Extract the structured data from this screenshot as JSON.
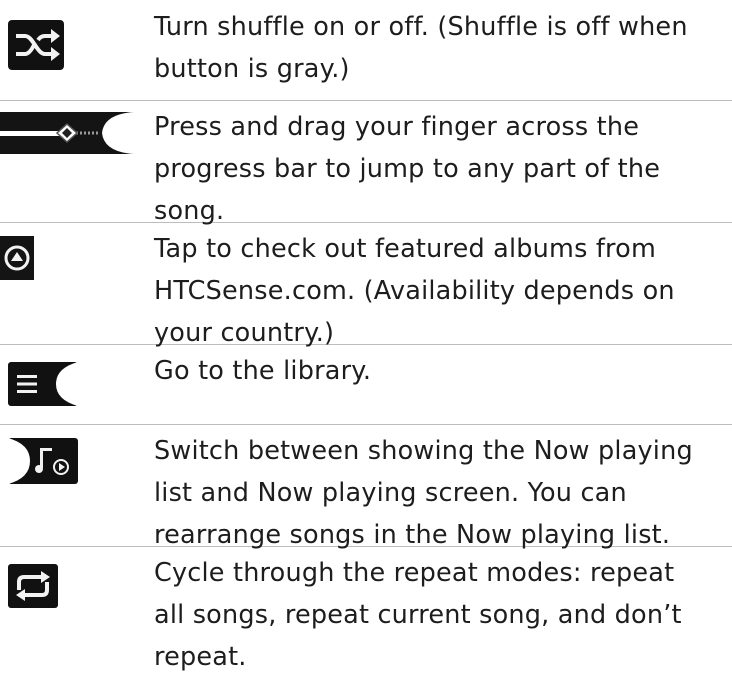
{
  "rows": [
    {
      "icon": "shuffle-icon",
      "text": "Turn shuffle on or off. (Shuffle is off when button is gray.)"
    },
    {
      "icon": "progress-bar-icon",
      "text": "Press and drag your finger across the progress bar to jump to any part of the song."
    },
    {
      "icon": "featured-albums-icon",
      "text": "Tap to check out featured albums from HTCSense.com. (Availability depends on your country.)"
    },
    {
      "icon": "library-icon",
      "text": "Go to the library."
    },
    {
      "icon": "now-playing-list-icon",
      "text": "Switch between showing the Now playing list and Now playing screen. You can rearrange songs in the Now playing list."
    },
    {
      "icon": "repeat-icon",
      "text": "Cycle through the repeat modes: repeat all songs, repeat current song, and don’t repeat."
    }
  ],
  "colors": {
    "icon_background": "#111111",
    "icon_foreground": "#f2f2f2",
    "divider": "#bdbdbd",
    "text": "#1d1d1d"
  }
}
